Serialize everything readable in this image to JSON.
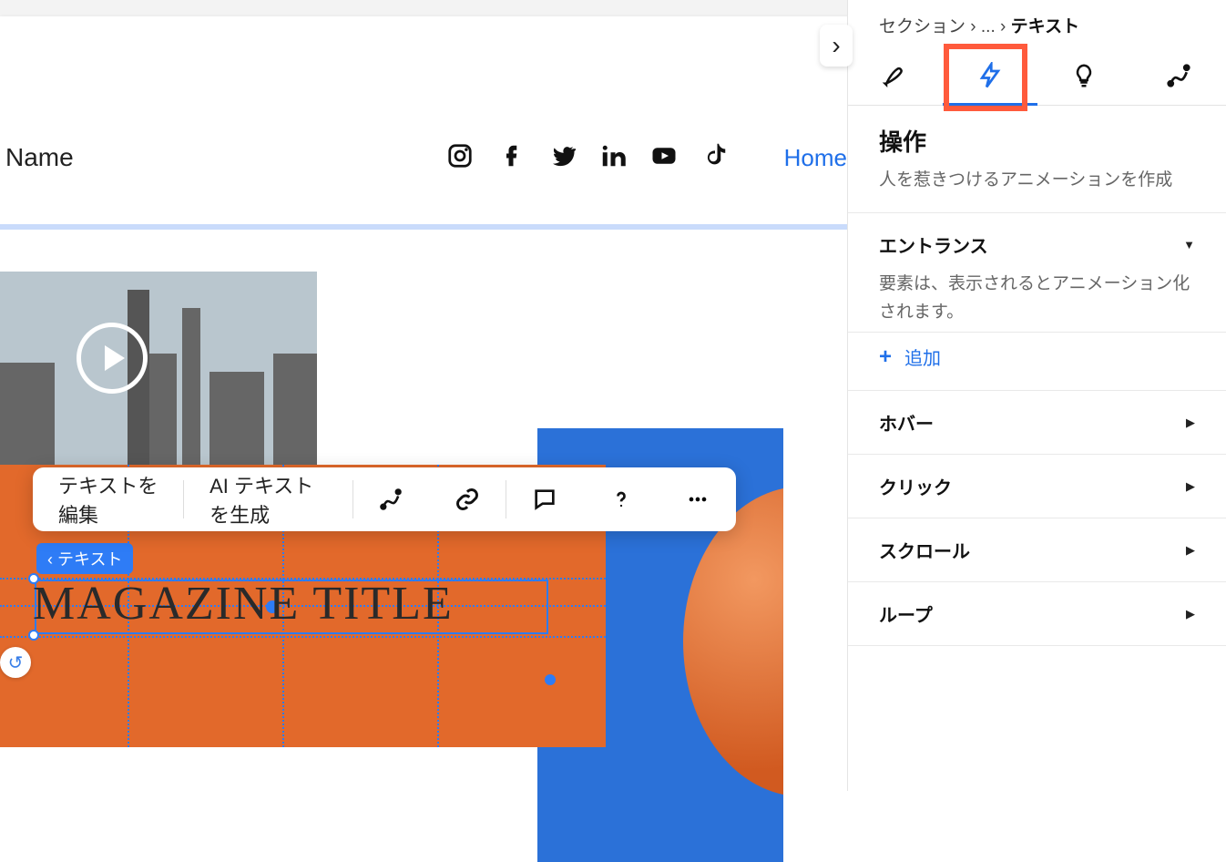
{
  "nav": {
    "site_name": "Name",
    "home_link": "Home"
  },
  "canvas": {
    "magazine_title": "MAGAZINE TITLE",
    "text_tag": "‹ テキスト"
  },
  "floating_toolbar": {
    "edit_text": "テキストを編集",
    "ai_text": "AI テキストを生成"
  },
  "breadcrumb": {
    "root": "セクション",
    "sep1": "›",
    "mid": "...",
    "sep2": "›",
    "current": "テキスト"
  },
  "panel": {
    "actions_title": "操作",
    "actions_desc": "人を惹きつけるアニメーションを作成",
    "entrance_title": "エントランス",
    "entrance_desc": "要素は、表示されるとアニメーション化されます。",
    "add_label": "追加",
    "hover_title": "ホバー",
    "click_title": "クリック",
    "scroll_title": "スクロール",
    "loop_title": "ループ"
  }
}
